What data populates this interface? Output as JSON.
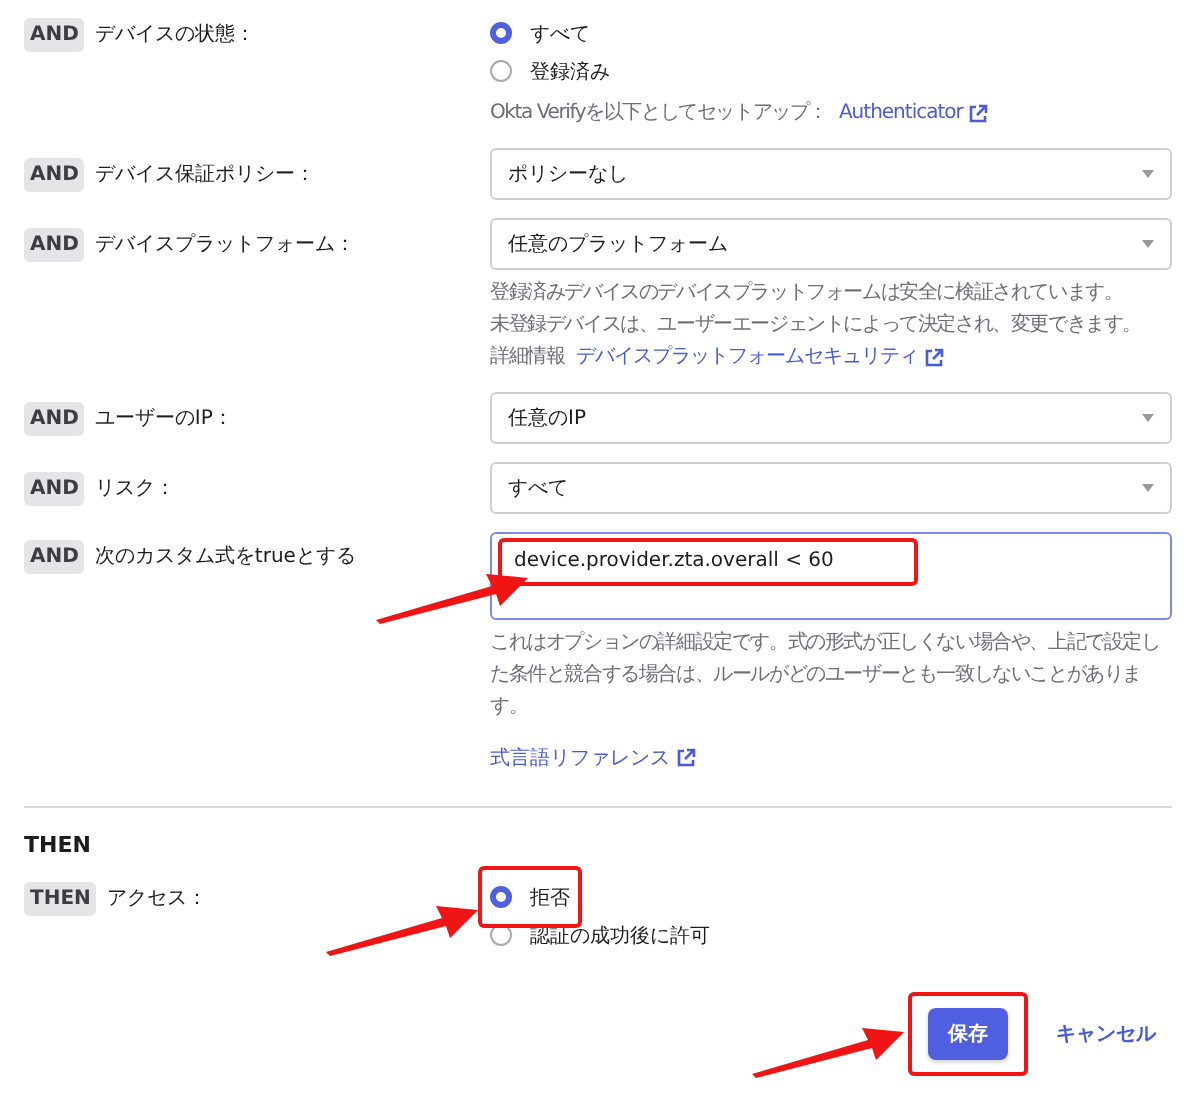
{
  "conditions": [
    {
      "badge": "AND",
      "label": "デバイスの状態：",
      "kind": "radio",
      "options": [
        {
          "label": "すべて",
          "selected": true
        },
        {
          "label": "登録済み",
          "selected": false
        }
      ],
      "hints": [
        {
          "text": "Okta Verifyを以下としてセットアップ：",
          "link": "Authenticator"
        }
      ]
    },
    {
      "badge": "AND",
      "label": "デバイス保証ポリシー：",
      "kind": "select",
      "value": "ポリシーなし"
    },
    {
      "badge": "AND",
      "label": "デバイスプラットフォーム：",
      "kind": "select",
      "value": "任意のプラットフォーム",
      "hints": [
        {
          "text": "登録済みデバイスのデバイスプラットフォームは安全に検証されています。"
        },
        {
          "text": "未登録デバイスは、ユーザーエージェントによって決定され、変更できます。"
        },
        {
          "text": "詳細情報",
          "link": "デバイスプラットフォームセキュリティ"
        }
      ]
    },
    {
      "badge": "AND",
      "label": "ユーザーのIP：",
      "kind": "select",
      "value": "任意のIP"
    },
    {
      "badge": "AND",
      "label": "リスク：",
      "kind": "select",
      "value": "すべて"
    },
    {
      "badge": "AND",
      "label": "次のカスタム式をtrueとする",
      "kind": "textarea",
      "value": "device.provider.zta.overall < 60",
      "highlighted": true,
      "hints": [
        {
          "text": "これはオプションの詳細設定です。式の形式が正しくない場合や、上記で設定した条件と競合する場合は、ルールがどのユーザーとも一致しないことがあります。"
        }
      ],
      "link": "式言語リファレンス"
    }
  ],
  "then": {
    "title": "THEN",
    "actions": [
      {
        "badge": "THEN",
        "label": "アクセス：",
        "kind": "radio",
        "options": [
          {
            "label": "拒否",
            "selected": true,
            "highlighted": true
          },
          {
            "label": "認証の成功後に許可",
            "selected": false
          }
        ]
      }
    ]
  },
  "buttons": [
    {
      "label": "保存",
      "kind": "primary",
      "highlighted": true
    },
    {
      "label": "キャンセル",
      "kind": "link"
    }
  ]
}
